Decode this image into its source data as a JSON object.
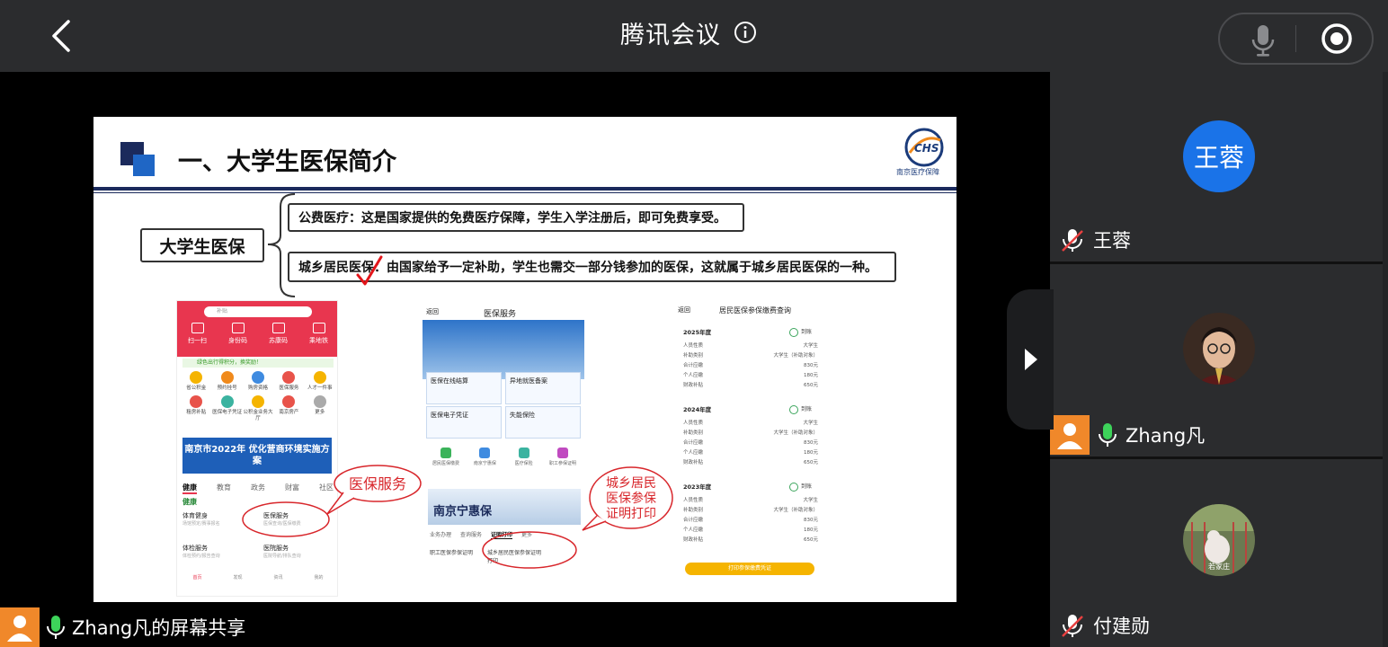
{
  "header": {
    "title": "腾讯会议",
    "icons": {
      "back": "chevron-left-icon",
      "info": "info-icon",
      "mic": "microphone-icon",
      "record": "record-icon"
    }
  },
  "slide": {
    "title": "一、大学生医保简介",
    "logo_caption": "南京医疗保障",
    "main_label": "大学生医保",
    "item1": "公费医疗：这是国家提供的免费医疗保障，学生入学注册后，即可免费享受。",
    "item2": "城乡居民医保：由国家给予一定补助，学生也需交一部分钱参加的医保，这就属于城乡居民医保的一种。",
    "callout1": "医保服务",
    "callout2_lines": [
      "城乡居民",
      "医保参保",
      "证明打印"
    ],
    "phone1": {
      "search": "补贴",
      "top_icons": [
        "扫一扫",
        "身份码",
        "苏康码",
        "乘地铁"
      ],
      "green_bar": "绿色出行得积分，换奖励！",
      "grid": [
        "省公积金",
        "预约挂号",
        "购房资格",
        "医保服务",
        "人才一件事",
        "租房补贴",
        "医保电子凭证",
        "公积金业务大厅",
        "南京房产",
        "更多"
      ],
      "banner": "南京市2022年 优化营商环境实施方案",
      "tabs": [
        "健康",
        "教育",
        "政务",
        "财富",
        "社区"
      ],
      "section": "健康",
      "items": [
        {
          "title": "体育健身",
          "sub": "场馆预定/赛事报名"
        },
        {
          "title": "医保服务",
          "sub": "医保查询/医保缴费"
        },
        {
          "title": "体检服务",
          "sub": "体检预约/报告查询"
        },
        {
          "title": "医院服务",
          "sub": "医院导航/排队查询"
        }
      ],
      "nav": [
        "首页",
        "发现",
        "资讯",
        "我的"
      ]
    },
    "phone2": {
      "back": "返回",
      "title": "医保服务",
      "cards": [
        "医保在线结算",
        "异地就医备案",
        "医保电子凭证",
        "失能保险"
      ],
      "row": [
        "居民医保缴费",
        "南京宁惠保",
        "医疗保险",
        "职工参保证明"
      ],
      "banner": "南京宁惠保",
      "tabs": [
        "业务办理",
        "查询服务",
        "证明打印",
        "更多"
      ],
      "items": [
        "职工医保参保证明",
        "城乡居民医保参保证明打印"
      ]
    },
    "phone3": {
      "back": "返回",
      "title": "居民医保参保缴费查询",
      "records": [
        {
          "year": "2025年度",
          "status": "到账",
          "rows": [
            [
              "人员性质",
              "大学生"
            ],
            [
              "补助类别",
              "大学生（补助对象）"
            ],
            [
              "合计应缴",
              "830元"
            ],
            [
              "个人应缴",
              "180元"
            ],
            [
              "财政补贴",
              "650元"
            ]
          ]
        },
        {
          "year": "2024年度",
          "status": "到账",
          "rows": [
            [
              "人员性质",
              "大学生"
            ],
            [
              "补助类别",
              "大学生（补助对象）"
            ],
            [
              "合计应缴",
              "830元"
            ],
            [
              "个人应缴",
              "180元"
            ],
            [
              "财政补贴",
              "650元"
            ]
          ]
        },
        {
          "year": "2023年度",
          "status": "到账",
          "rows": [
            [
              "人员性质",
              "大学生"
            ],
            [
              "补助类别",
              "大学生（补助对象）"
            ],
            [
              "合计应缴",
              "830元"
            ],
            [
              "个人应缴",
              "180元"
            ],
            [
              "财政补贴",
              "650元"
            ]
          ]
        }
      ],
      "button": "打印参保缴费凭证"
    }
  },
  "participants": [
    {
      "name": "王蓉",
      "avatar_text": "王蓉",
      "mic": "muted"
    },
    {
      "name": "Zhang凡",
      "mic": "on"
    },
    {
      "name": "付建勋",
      "mic": "muted"
    }
  ],
  "share_label": "Zhang凡的屏幕共享",
  "colors": {
    "topbar": "#2b2c2e",
    "avatar_blue": "#1a73e8",
    "avatar_orange": "#f0882a",
    "mic_green": "#3dd35a",
    "callout_red": "#d8262b"
  }
}
